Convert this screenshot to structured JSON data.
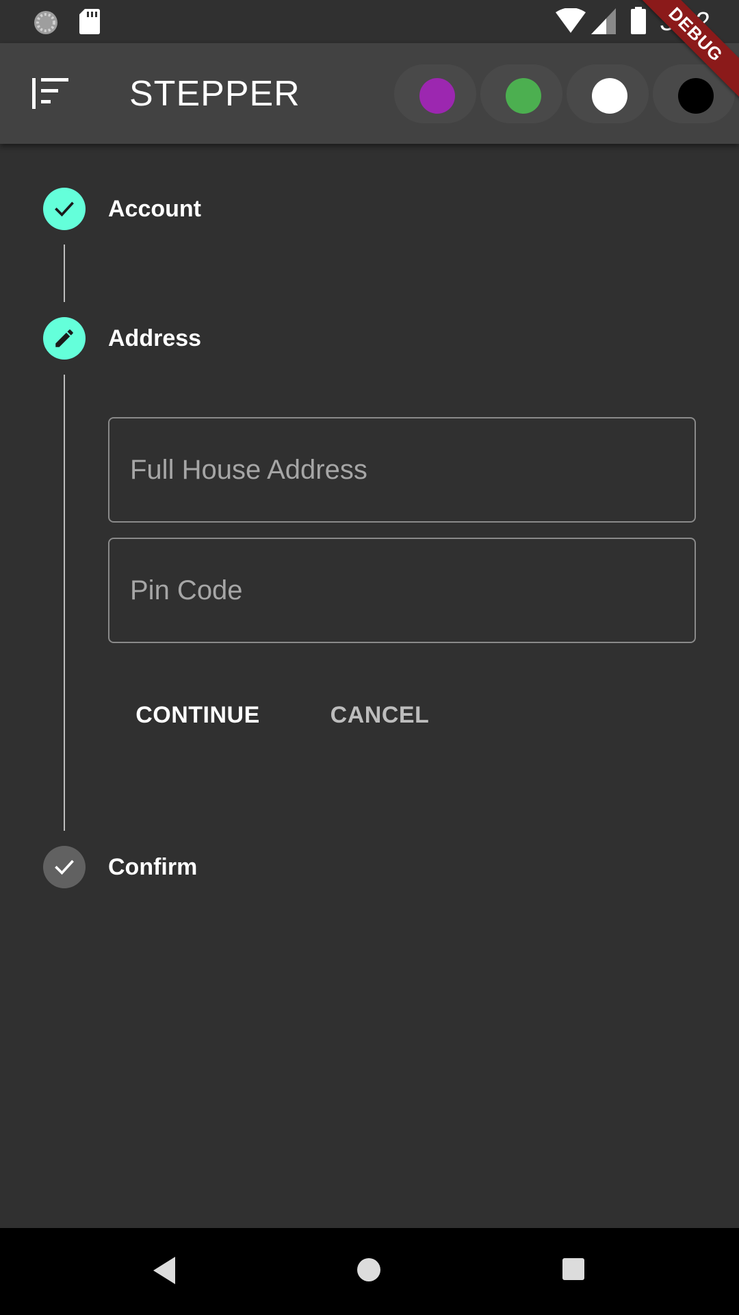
{
  "status_bar": {
    "time": "3:42",
    "icons": [
      "loading-icon",
      "sd-card-icon",
      "wifi-icon",
      "cell-signal-icon",
      "battery-icon"
    ]
  },
  "debug_banner": "DEBUG",
  "app_bar": {
    "title": "STEPPER",
    "menu_icon": "sort-menu-icon",
    "theme_colors": [
      "#9c27b0",
      "#4caf50",
      "#ffffff",
      "#000000"
    ]
  },
  "stepper": {
    "accent_color": "#64ffda",
    "inactive_color": "#616161",
    "steps": [
      {
        "label": "Account",
        "state": "complete",
        "icon": "check-icon"
      },
      {
        "label": "Address",
        "state": "editing",
        "icon": "pencil-icon"
      },
      {
        "label": "Confirm",
        "state": "inactive",
        "icon": "check-icon"
      }
    ],
    "address_form": {
      "full_address": {
        "placeholder": "Full House Address",
        "value": ""
      },
      "pin_code": {
        "placeholder": "Pin Code",
        "value": ""
      }
    },
    "continue_label": "CONTINUE",
    "cancel_label": "CANCEL"
  },
  "nav_bar": {
    "icons": [
      "back-icon",
      "home-icon",
      "recents-icon"
    ]
  }
}
